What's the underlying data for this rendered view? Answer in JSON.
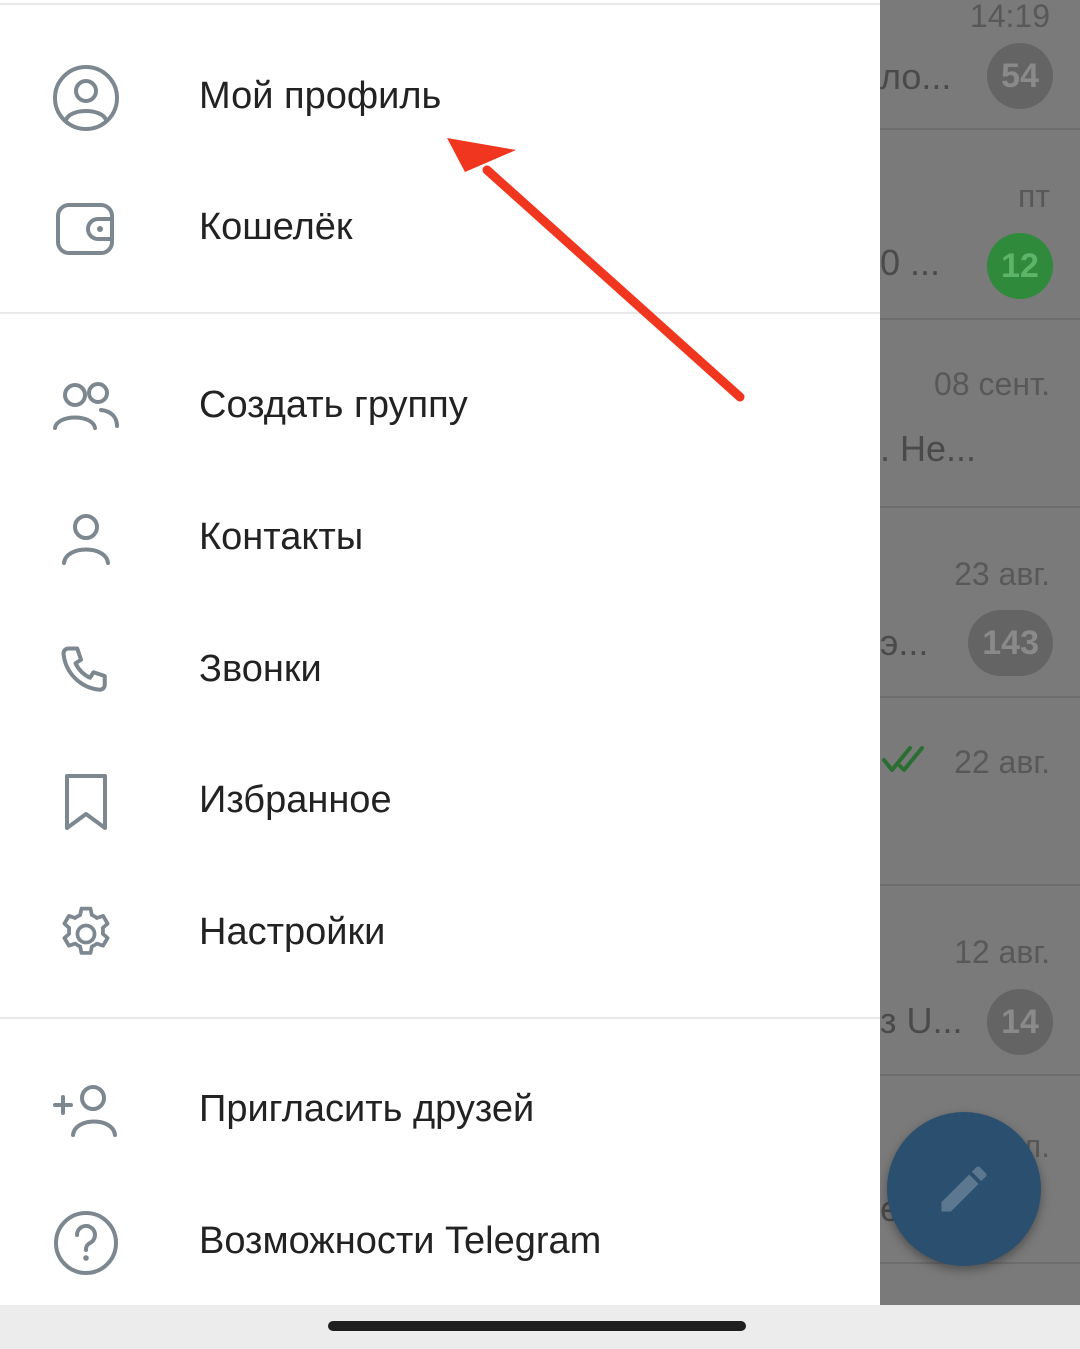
{
  "drawer": {
    "items_top": [
      {
        "label": "Мой профиль",
        "icon": "profile-circle-icon"
      },
      {
        "label": "Кошелёк",
        "icon": "wallet-icon"
      }
    ],
    "items_main": [
      {
        "label": "Создать группу",
        "icon": "group-icon"
      },
      {
        "label": "Контакты",
        "icon": "contact-icon"
      },
      {
        "label": "Звонки",
        "icon": "phone-icon"
      },
      {
        "label": "Избранное",
        "icon": "bookmark-icon"
      },
      {
        "label": "Настройки",
        "icon": "gear-icon"
      }
    ],
    "items_bottom": [
      {
        "label": "Пригласить друзей",
        "icon": "add-user-icon"
      },
      {
        "label": "Возможности Telegram",
        "icon": "help-icon"
      }
    ]
  },
  "chatlist": {
    "rows": [
      {
        "time": "14:19",
        "snippet": "ло...",
        "badge": "54",
        "badge_color": "gray"
      },
      {
        "time": "пт",
        "snippet": "0 ...",
        "badge": "12",
        "badge_color": "green"
      },
      {
        "time": "08 сент.",
        "snippet": ". Не...",
        "badge": "",
        "badge_color": ""
      },
      {
        "time": "23 авг.",
        "snippet": "э...",
        "badge": "143",
        "badge_color": "gray"
      },
      {
        "time": "22 авг.",
        "snippet": "",
        "badge": "",
        "badge_color": "",
        "read_checks": true
      },
      {
        "time": "12 авг.",
        "snippet": "з U...",
        "badge": "14",
        "badge_color": "gray"
      },
      {
        "time": "л.",
        "snippet": "е",
        "badge": "",
        "badge_color": ""
      }
    ]
  },
  "fab": {
    "icon": "pencil-icon"
  },
  "colors": {
    "annotation_arrow": "#f0361f",
    "icon_gray": "#7c8790",
    "fab_blue": "#2b4f6e",
    "badge_green": "#2f8a3b"
  }
}
